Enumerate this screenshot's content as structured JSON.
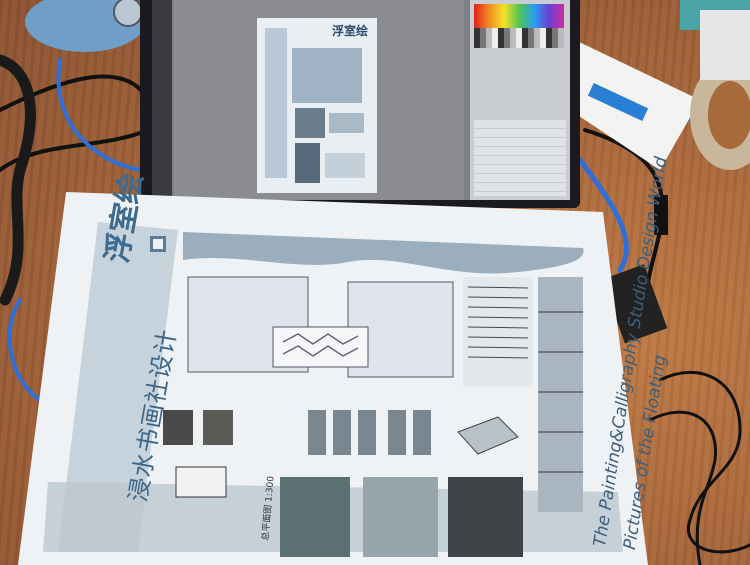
{
  "photo": {
    "screen_doc_title": "浮室绘",
    "poster": {
      "title_cn": "浮室绘",
      "subtitle_cn": "浸水书画社设计",
      "title_en_line1": "The Painting&Calligraphy Studio Design World",
      "title_en_line2": "Pictures of the Floating",
      "scale_label": "总平面图 1:300"
    }
  },
  "colors": {
    "desk": "#a86a3a",
    "poster_blue": "#3d6a8f",
    "cable_blue": "#2f6fd8"
  }
}
